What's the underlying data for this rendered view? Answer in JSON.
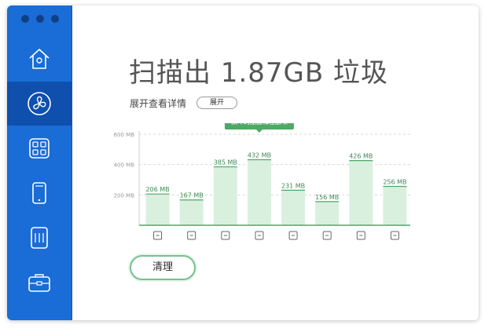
{
  "app": {
    "title": "扫描出 1.87GB 垃圾"
  },
  "header": {
    "title": "扫描出 1.87GB 垃圾",
    "subtitle": "展开查看详情",
    "expand_label": "展开"
  },
  "sidebar": {
    "items": [
      {
        "name": "home",
        "icon": "house-icon",
        "active": false
      },
      {
        "name": "cleaner",
        "icon": "fan-icon",
        "active": true
      },
      {
        "name": "apps",
        "icon": "grid-icon",
        "active": false
      },
      {
        "name": "device",
        "icon": "tablet-icon",
        "active": false
      },
      {
        "name": "memory",
        "icon": "chip-icon",
        "active": false
      },
      {
        "name": "toolbox",
        "icon": "toolbox-icon",
        "active": false
      }
    ]
  },
  "tooltip": {
    "text": "损坏的配置和注册项"
  },
  "action": {
    "clean_label": "清理"
  },
  "colors": {
    "sidebar": "#1a6cd6",
    "sidebar_active": "#0f4fae",
    "accent_green": "#4ea866",
    "bar_fill": "#d9f0df"
  },
  "chart_data": {
    "type": "bar",
    "yticks": [
      "200 MB",
      "400 MB",
      "600 MB"
    ],
    "ylim": [
      0,
      600
    ],
    "unit": "MB",
    "values": [
      206,
      167,
      385,
      432,
      231,
      156,
      426,
      256
    ],
    "labels": [
      "206 MB",
      "167 MB",
      "385 MB",
      "432 MB",
      "231 MB",
      "156 MB",
      "426 MB",
      "256 MB"
    ],
    "highlight_index": 3,
    "category_icons": [
      "cache-icon",
      "log-icon",
      "leftover-icon",
      "config-icon",
      "image-icon",
      "browser-icon",
      "book-icon",
      "globe-icon"
    ],
    "grid": true
  }
}
